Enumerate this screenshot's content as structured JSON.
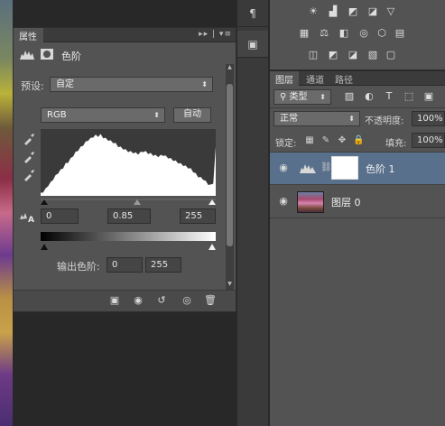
{
  "properties_panel": {
    "tab_label": "属性",
    "tab_controls": "▸▸ | ▾≡",
    "adjustment_title": "色阶",
    "preset_label": "预设:",
    "preset_value": "自定",
    "channel_value": "RGB",
    "auto_button": "自动",
    "input_black": "0",
    "input_gamma": "0.85",
    "input_white": "255",
    "output_label": "输出色阶:",
    "output_black": "0",
    "output_white": "255"
  },
  "histogram": {
    "color": "#ffffff",
    "levels": [
      0.05,
      0.08,
      0.12,
      0.18,
      0.22,
      0.28,
      0.33,
      0.38,
      0.42,
      0.46,
      0.52,
      0.55,
      0.6,
      0.65,
      0.7,
      0.74,
      0.78,
      0.82,
      0.86,
      0.9,
      0.92,
      0.95,
      0.97,
      0.96,
      0.98,
      0.94,
      0.92,
      0.9,
      0.88,
      0.86,
      0.84,
      0.8,
      0.78,
      0.76,
      0.74,
      0.72,
      0.71,
      0.7,
      0.69,
      0.68,
      0.7,
      0.72,
      0.71,
      0.69,
      0.68,
      0.66,
      0.65,
      0.64,
      0.65,
      0.66,
      0.64,
      0.62,
      0.6,
      0.58,
      0.56,
      0.54,
      0.52,
      0.5,
      0.48,
      0.46,
      0.44,
      0.4,
      0.36,
      0.32,
      0.3,
      0.28,
      0.24,
      0.2,
      0.18,
      0.22,
      0.78
    ]
  },
  "dock": {
    "paragraph_icon": "¶",
    "tools_icon": "▣"
  },
  "layers_panel": {
    "tabs": [
      "图层",
      "通道",
      "路径"
    ],
    "kind_filter": "类型",
    "blend_mode": "正常",
    "opacity_label": "不透明度:",
    "opacity_value": "100%",
    "lock_label": "锁定:",
    "fill_label": "填充:",
    "fill_value": "100%",
    "layers": [
      {
        "name": "色阶 1",
        "selected": true
      },
      {
        "name": "图层 0",
        "selected": false
      }
    ]
  },
  "colors": {
    "accent_selected": "#59708d",
    "panel_bg": "#535353",
    "dark_bg": "#282828"
  }
}
